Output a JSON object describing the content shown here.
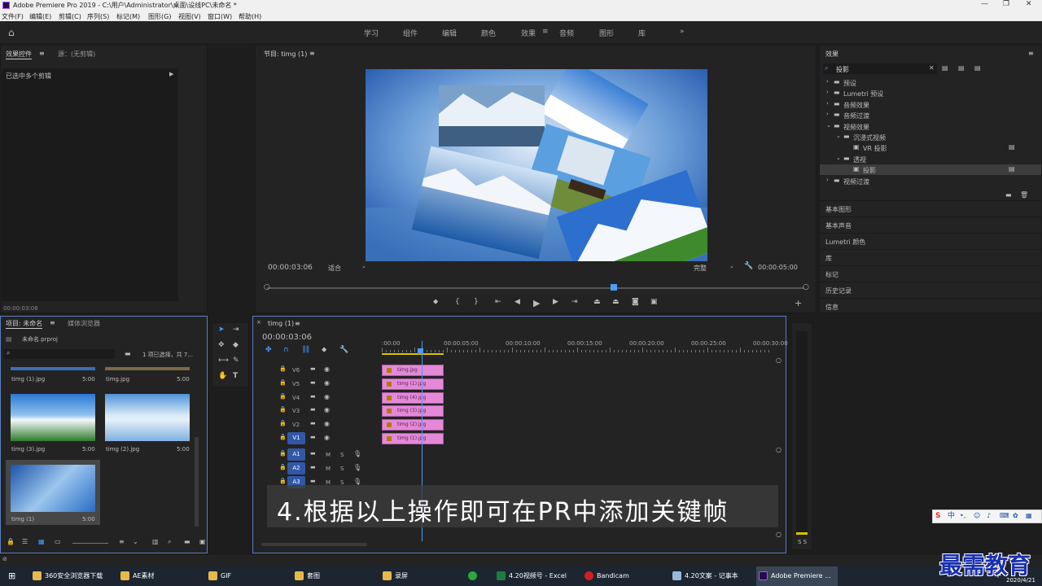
{
  "window": {
    "title": "Adobe Premiere Pro 2019 - C:\\用户\\Administrator\\桌面\\设线PC\\未命名 *",
    "menu": [
      "文件(F)",
      "编辑(E)",
      "剪辑(C)",
      "序列(S)",
      "标记(M)",
      "图形(G)",
      "视图(V)",
      "窗口(W)",
      "帮助(H)"
    ]
  },
  "workspaces": {
    "items": [
      "学习",
      "组件",
      "编辑",
      "颜色",
      "效果",
      "音频",
      "图形",
      "库"
    ],
    "active": "效果"
  },
  "effect_controls": {
    "tab1": "效果控件",
    "tab2": "源：(无剪辑)",
    "selection_label": "已选中多个剪辑",
    "timecode": "00:00:03:06"
  },
  "program": {
    "title": "节目: timg (1)",
    "timecode": "00:00:03:06",
    "fit": "适合",
    "quality": "完整",
    "duration": "00:00:05:00",
    "playhead_fraction": 0.645
  },
  "effects_panel": {
    "title": "效果",
    "search_value": "投影",
    "tree": [
      {
        "label": "预设",
        "level": 0,
        "type": "folder"
      },
      {
        "label": "Lumetri 预设",
        "level": 0,
        "type": "folder"
      },
      {
        "label": "音频效果",
        "level": 0,
        "type": "folder"
      },
      {
        "label": "音频过渡",
        "level": 0,
        "type": "folder"
      },
      {
        "label": "视频效果",
        "level": 0,
        "type": "folder-open"
      },
      {
        "label": "沉浸式视频",
        "level": 1,
        "type": "folder-open"
      },
      {
        "label": "VR 投影",
        "level": 2,
        "type": "effect"
      },
      {
        "label": "透视",
        "level": 1,
        "type": "folder-open"
      },
      {
        "label": "投影",
        "level": 2,
        "type": "effect",
        "selected": true
      },
      {
        "label": "视频过渡",
        "level": 0,
        "type": "folder"
      }
    ],
    "collapsed_panels": [
      "基本图形",
      "基本声音",
      "Lumetri 颜色",
      "库",
      "标记",
      "历史记录",
      "信息"
    ]
  },
  "project": {
    "tab1": "项目: 未命名",
    "tab2": "媒体浏览器",
    "file": "未命名.prproj",
    "selection_info": "1 项已选择，共 7...",
    "items": [
      {
        "name": "timg (1).jpg",
        "duration": "5:00"
      },
      {
        "name": "timg.jpg",
        "duration": "5:00"
      },
      {
        "name": "timg (3).jpg",
        "duration": "5:00"
      },
      {
        "name": "timg (2).jpg",
        "duration": "5:00"
      },
      {
        "name": "timg (1)",
        "duration": "5:00"
      }
    ]
  },
  "timeline": {
    "tab": "timg (1)",
    "timecode": "00:00:03:06",
    "ruler": [
      ":00:00",
      "00:00:05:00",
      "00:00:10:00",
      "00:00:15:00",
      "00:00:20:00",
      "00:00:25:00",
      "00:00:30:00"
    ],
    "video_tracks": [
      {
        "name": "V6",
        "clip": "timg.jpg"
      },
      {
        "name": "V5",
        "clip": "timg (1).jpg"
      },
      {
        "name": "V4",
        "clip": "timg (4).jpg"
      },
      {
        "name": "V3",
        "clip": "timg (3).jpg"
      },
      {
        "name": "V2",
        "clip": "timg (2).jpg"
      },
      {
        "name": "V1",
        "clip": "timg (1).jpg"
      }
    ],
    "audio_tracks": [
      "A1",
      "A2",
      "A3"
    ],
    "audio_buttons": {
      "mute": "M",
      "solo": "S"
    },
    "meter_label": "S S"
  },
  "subtitle": "4.根据以上操作即可在PR中添加关键帧",
  "watermark": "最需教育",
  "taskbar": {
    "items": [
      "360安全浏览器下载",
      "AE素材",
      "GIF",
      "套图",
      "录屏",
      "4.20视频号 - Excel",
      "Bandicam",
      "4.20文案 - 记事本",
      "Adobe Premiere ..."
    ],
    "ime": "中",
    "date": "2020/4/21"
  },
  "colors": {
    "accent": "#4a9cff",
    "clip": "#e489d8",
    "track_active": "#3158a6"
  }
}
